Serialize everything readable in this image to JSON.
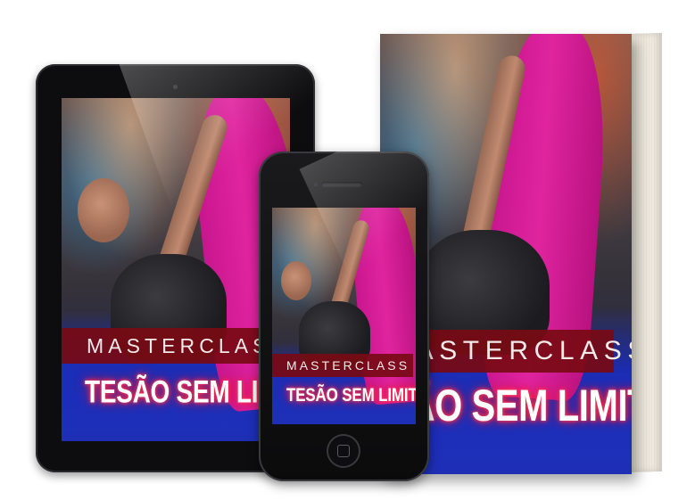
{
  "product": {
    "title": "MASTERCLASS",
    "subtitle": "TESÃO SEM LIMITES"
  },
  "colors": {
    "band": "#780a14",
    "glow": "#ff2a4a",
    "leggings": "#e0249f",
    "mat": "#1e2fb6",
    "device": "#0d0d0f"
  },
  "icons": {
    "home_button": "home-button-icon",
    "camera": "camera-icon",
    "speaker": "speaker-icon"
  }
}
